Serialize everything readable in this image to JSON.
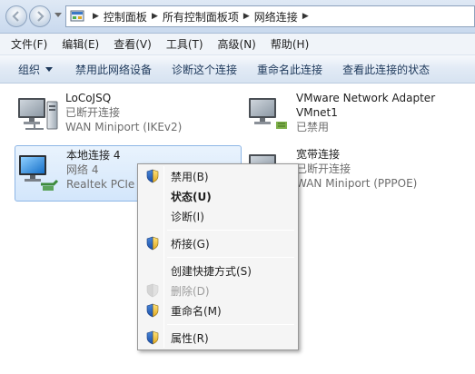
{
  "address_bar": {
    "breadcrumbs": [
      "控制面板",
      "所有控制面板项",
      "网络连接"
    ]
  },
  "menu": {
    "items": [
      "文件(F)",
      "编辑(E)",
      "查看(V)",
      "工具(T)",
      "高级(N)",
      "帮助(H)"
    ]
  },
  "command_bar": {
    "organize": "组织",
    "items": [
      "禁用此网络设备",
      "诊断这个连接",
      "重命名此连接",
      "查看此连接的状态"
    ]
  },
  "connections": [
    {
      "name": "LoCoJSQ",
      "status": "已断开连接",
      "device": "WAN Miniport (IKEv2)"
    },
    {
      "name": "VMware Network Adapter",
      "name2": "VMnet1",
      "status": "已禁用"
    },
    {
      "name": "本地连接 4",
      "status": "网络  4",
      "device": "Realtek PCIe GBE Family Controller",
      "device_visible": "Realtek PCIe G",
      "selected": true
    },
    {
      "name": "宽带连接",
      "status": "已断开连接",
      "device": "WAN Miniport (PPPOE)"
    }
  ],
  "context_menu": {
    "items": [
      {
        "label": "禁用(B)",
        "icon": "shield-icon"
      },
      {
        "label": "状态(U)",
        "bold": true
      },
      {
        "label": "诊断(I)"
      },
      {
        "label": "桥接(G)",
        "icon": "shield-icon"
      },
      {
        "label": "创建快捷方式(S)"
      },
      {
        "label": "删除(D)",
        "icon": "shield-icon",
        "disabled": true
      },
      {
        "label": "重命名(M)",
        "icon": "shield-icon"
      },
      {
        "label": "属性(R)",
        "icon": "shield-icon"
      }
    ]
  },
  "colors": {
    "selection_border": "#8eb6e6",
    "command_text": "#1e395b",
    "status_text": "#6d6d6d"
  }
}
